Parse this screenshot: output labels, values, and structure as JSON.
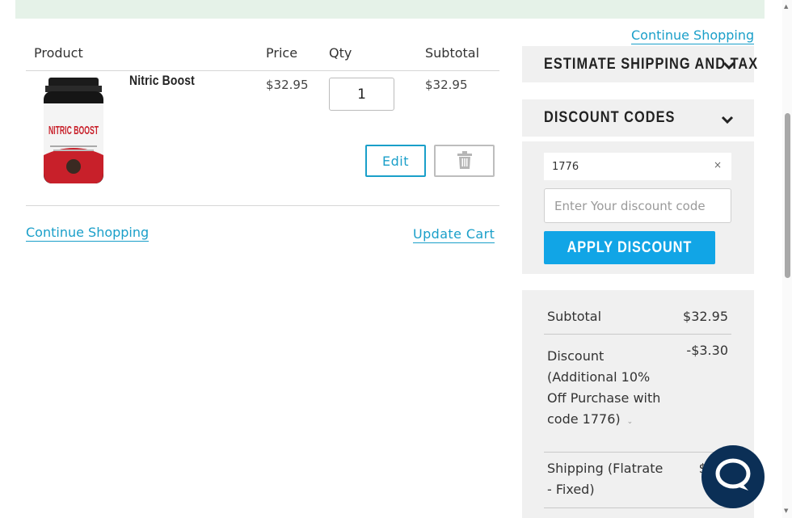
{
  "links": {
    "continue_shopping_top": "Continue Shopping",
    "continue_shopping_bottom": "Continue Shopping",
    "update_cart": "Update Cart"
  },
  "cart": {
    "columns": [
      "Product",
      "Price",
      "Qty",
      "Subtotal"
    ],
    "item": {
      "name": "Nitric Boost",
      "image_text": "NITRIC BOOST",
      "price": "$32.95",
      "qty": "1",
      "subtotal": "$32.95",
      "edit_label": "Edit"
    }
  },
  "sidebar": {
    "shipping_title": "ESTIMATE SHIPPING AND TAX",
    "discount_title": "DISCOUNT CODES",
    "applied_code": "1776",
    "discount_placeholder": "Enter Your discount code",
    "apply_label": "APPLY DISCOUNT"
  },
  "summary": {
    "subtotal_label": "Subtotal",
    "subtotal_value": "$32.95",
    "discount_label_lines": [
      "Discount",
      "(Additional 10%",
      "Off Purchase with",
      "code 1776)"
    ],
    "discount_value": "-$3.30",
    "shipping_label_lines": [
      "Shipping (Flatrate",
      "- Fixed)"
    ],
    "shipping_value": "$5"
  },
  "colors": {
    "accent": "#1a9fc9",
    "apply_button": "#11a5e6",
    "chat": "#0b2f56",
    "notice_bg": "#e5f2e8"
  }
}
